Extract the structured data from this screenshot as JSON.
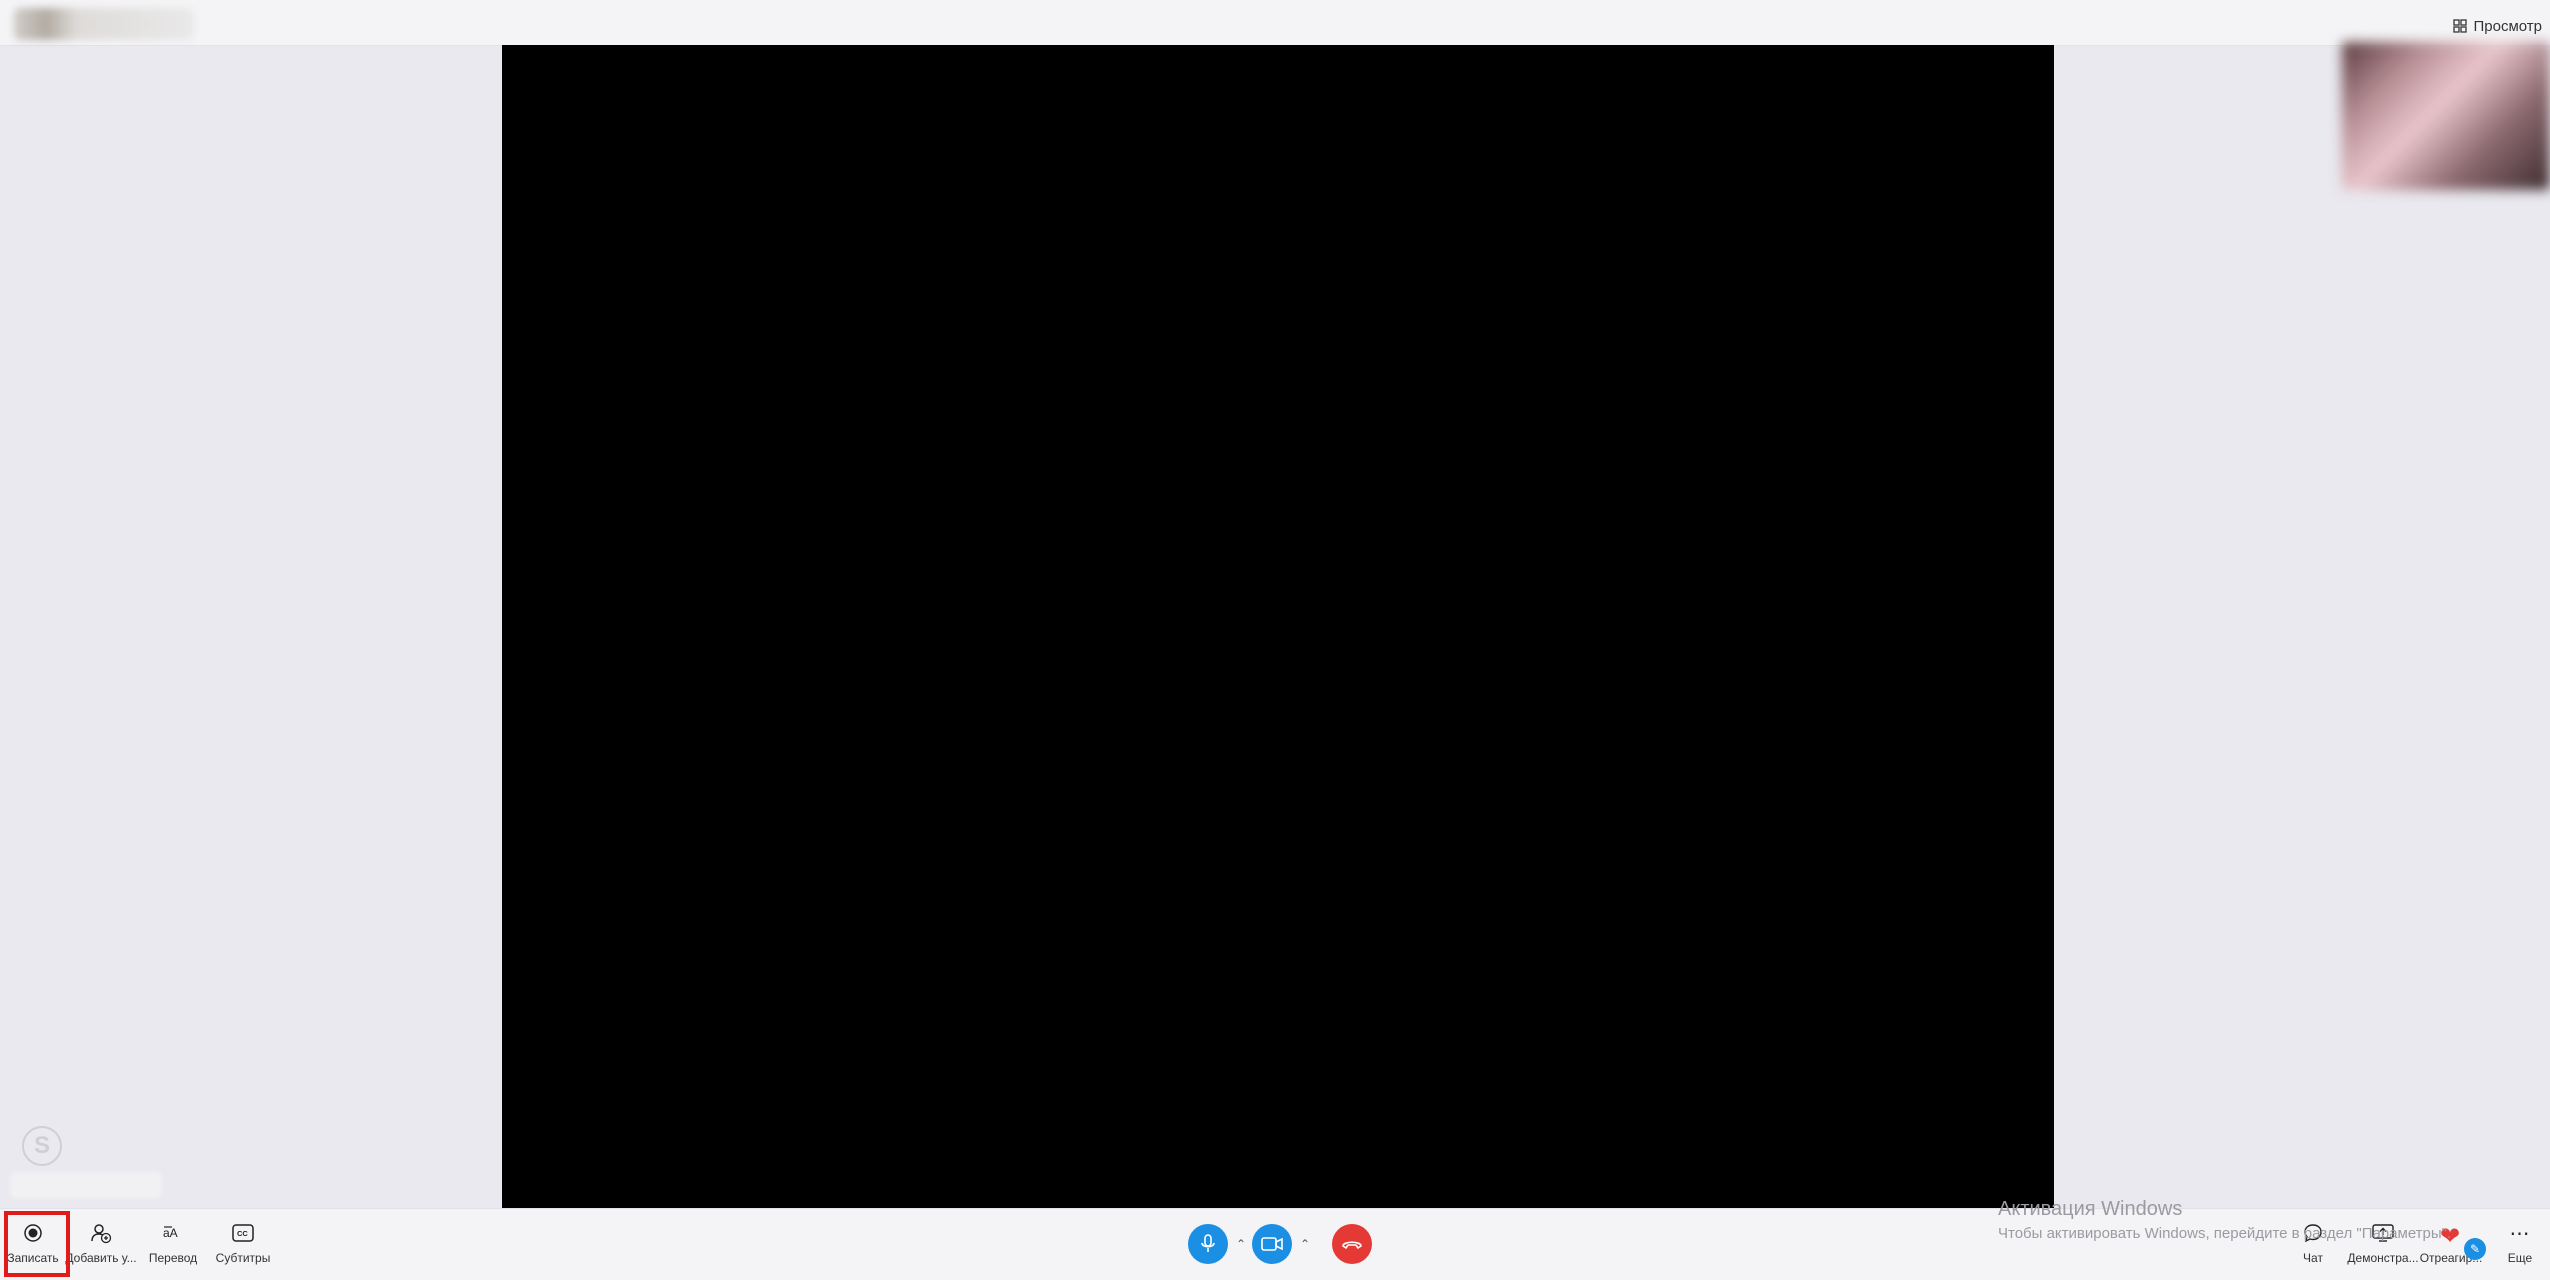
{
  "header": {
    "view_label": "Просмотр",
    "view_icon": "grid-icon"
  },
  "toolbar": {
    "record_label": "Записать",
    "add_people_label": "Добавить у...",
    "translate_label": "Перевод",
    "subtitles_label": "Субтитры",
    "subtitles_icon_text": "CC",
    "chat_label": "Чат",
    "share_label": "Демонстра...",
    "react_label": "Отреагир...",
    "more_label": "Еще"
  },
  "call_controls": {
    "mic_icon": "microphone-icon",
    "camera_icon": "camera-icon",
    "hangup_icon": "hangup-icon",
    "accent": "#1a8fe3",
    "hangup_color": "#e53935"
  },
  "windows_activation": {
    "title": "Активация Windows",
    "subtitle": "Чтобы активировать Windows, перейдите в раздел \"Параметры\"."
  },
  "highlight_color": "#e01b1b"
}
